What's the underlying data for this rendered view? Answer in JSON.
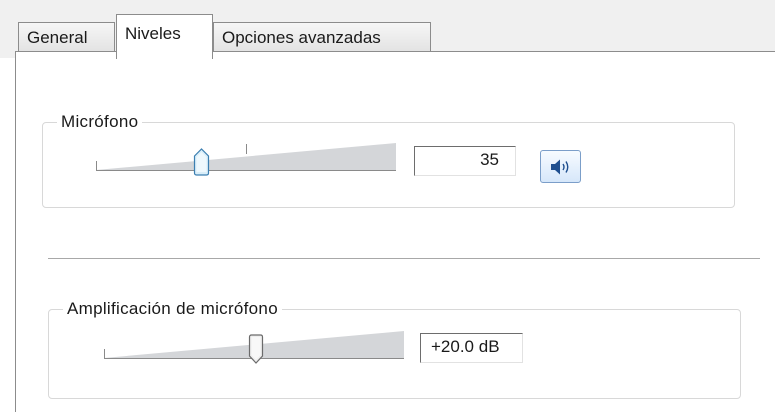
{
  "tabs": [
    {
      "label": "General",
      "active": false
    },
    {
      "label": "Niveles",
      "active": true
    },
    {
      "label": "Opciones avanzadas",
      "active": false
    }
  ],
  "microphone": {
    "label": "Micrófono",
    "level": 35,
    "value_text": "35",
    "mute_icon": "speaker-icon"
  },
  "boost": {
    "label": "Amplificación de micrófono",
    "value_text": "+20.0 dB",
    "level_fraction": 0.5
  },
  "colors": {
    "thumb_active_fill": "#d9eef9",
    "thumb_active_stroke": "#3c7fb1",
    "thumb_fill": "#eeeeee",
    "thumb_stroke": "#6b6b6b",
    "track_fill": "#d4d6d9"
  }
}
